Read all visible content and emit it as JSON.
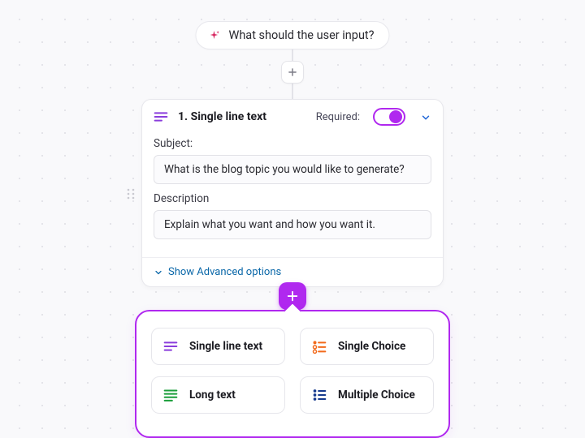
{
  "prompt": {
    "text": "What should the user input?"
  },
  "field_card": {
    "title": "1. Single line text",
    "required_label": "Required:",
    "required_on": true,
    "subject_label": "Subject:",
    "subject_value": "What is the blog topic you would like to generate?",
    "description_label": "Description",
    "description_value": "Explain what you want and how you want it.",
    "advanced_label": "Show Advanced options"
  },
  "field_types": [
    {
      "label": "Single line text",
      "icon": "lines-purple"
    },
    {
      "label": "Single Choice",
      "icon": "radio-orange"
    },
    {
      "label": "Long text",
      "icon": "lines-green"
    },
    {
      "label": "Multiple Choice",
      "icon": "checklist-blue"
    }
  ],
  "colors": {
    "accent": "#b028ef"
  }
}
